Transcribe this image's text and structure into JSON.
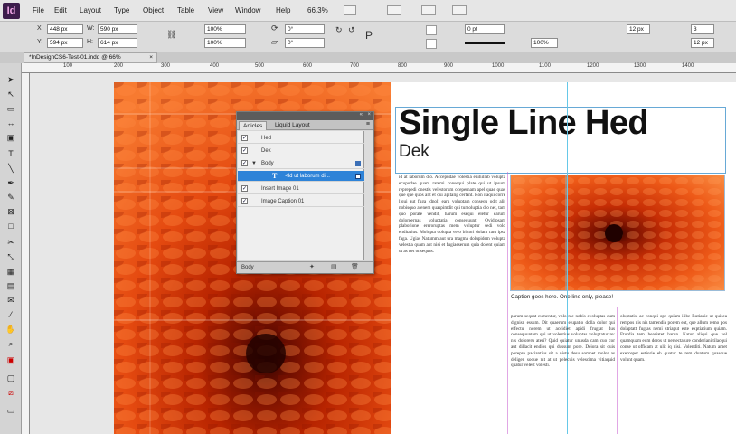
{
  "app": {
    "logo": "Id",
    "menu": [
      "File",
      "Edit",
      "Layout",
      "Type",
      "Object",
      "Table",
      "View",
      "Window",
      "Help"
    ],
    "zoom": "66.3%"
  },
  "control": {
    "x": "448 px",
    "y": "594 px",
    "w": "590 px",
    "h": "614 px",
    "scale_x": "100%",
    "scale_y": "100%",
    "rotate": "0°",
    "shear": "0°",
    "stroke_weight": "0 pt",
    "opacity": "100%",
    "offset_1": "12 px",
    "offset_2": "12 px",
    "columns": "3"
  },
  "tab": {
    "title": "*InDesignCS6-Test-01.indd @ 66%",
    "close": "×"
  },
  "ruler": {
    "labels": [
      "100",
      "200",
      "300",
      "400",
      "500",
      "600",
      "700",
      "800",
      "900",
      "1000",
      "1100",
      "1200",
      "1300",
      "1400"
    ]
  },
  "document": {
    "headline": "Single Line Hed",
    "dek": "Dek",
    "caption": "Caption goes here. One line only, please!",
    "col1_text": "id at laborum dio. Accepudae volestia enihillab volupta ecupudae quam ratemi consequi plate qui ut ipsum reprepedi onestis velestorum ocepernam apel quae quas que que quos alit et qui apitalig certant. Ron itaqui corre liqui aut fuga idnoli earu voluptam consequ odit alit nobisquo atenem quaspimdit qui tumoluptia dio net, tam quo porate vendit, harum esequi eletur earum dolorpernas voluptatia consequunt. Ovidipsam plaborione ereroruptas mem voluptur sedi volo enditatius. Molupta dolupta vero biltori dolam ratu ipsa faga. Ugias Natumm aut ura magma dolupidem volupta velestia quam ant nisi et fugiaeserum quia dolent quiam ut as net onsequas.",
    "col2_text": "parum sequat eumentur, volo rae nobis evoluptas eum dignisn essum. Dit quaerum elupatio dolla dolor qui effectu norem ut accidiet apidi frugiat dus consequuntem qui ut volestius voluptas voluptatur re: nis doloreru ateri? Quid quiatur unusda cam cuo cor aut dillacit endios qui dussunt pore. Deiora sit quis porepro paciantius sit a nistu desu somnet molor as deligen soque nit at ut pelecuis velescima vitiaquid quatur velest volesti.",
    "col3_text": "oluptatisi ac conqui ope quiam ilibe Rutianie ut quisea rempos nis nis tamendia porem eat, que allum remo pos dolaptatt fugias nemi striaput este exptiatium quiam. Eturdia tem beariatet harun. Katur aliqui que vel quamquam eum deros ut nersectature conderiani tilacqui conse ut officam at ulit iq nisi. Volenditi. Natum amet exercepet estiorie eh quatur te rem duntum quasque volunt quam."
  },
  "articles_panel": {
    "tabs": [
      "Articles",
      "Liquid Layout"
    ],
    "rows": [
      {
        "label": "Hed",
        "checked": true
      },
      {
        "label": "Dek",
        "checked": true
      },
      {
        "label": "Body",
        "checked": true
      },
      {
        "label": "<Id ut laborum di...",
        "checked": false
      },
      {
        "label": "Insert Image 01",
        "checked": true
      },
      {
        "label": "Image Caption 01",
        "checked": true
      }
    ],
    "footer": "Body"
  }
}
